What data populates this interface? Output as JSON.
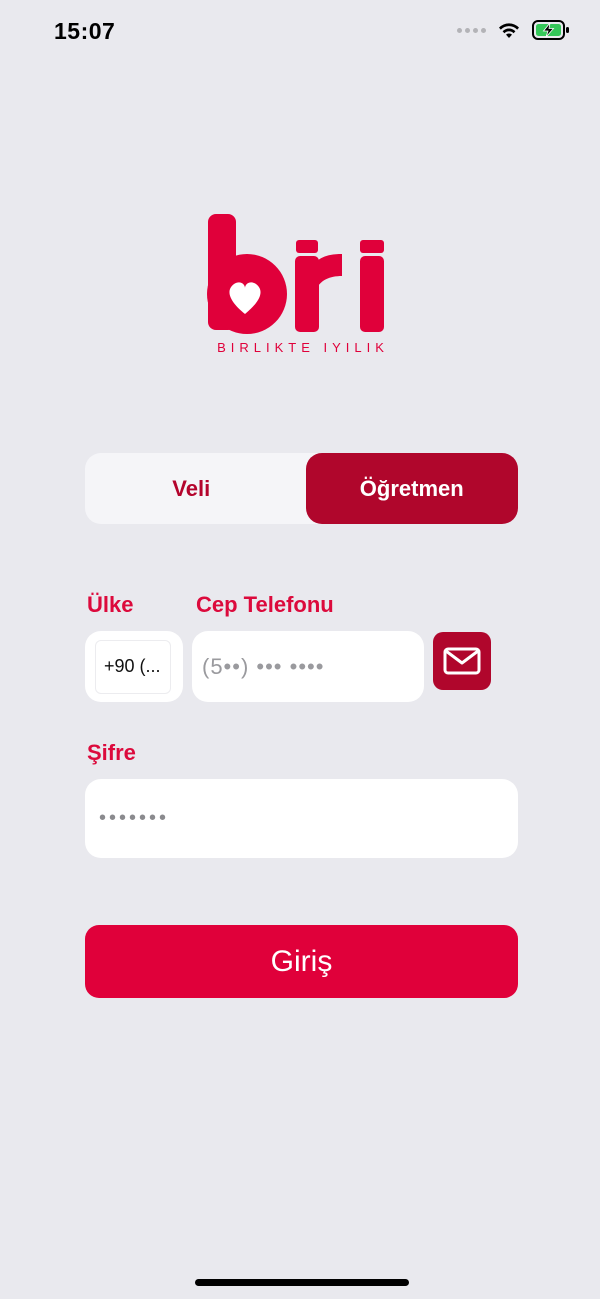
{
  "status_bar": {
    "time": "15:07",
    "icons": [
      "signal-dots-icon",
      "wifi-icon",
      "battery-charging-icon"
    ]
  },
  "logo": {
    "wordmark": "biri",
    "tagline": "BIRLIKTE IYILIK",
    "color": "#e0003a"
  },
  "segmented": {
    "options": [
      "Veli",
      "Öğretmen"
    ],
    "selected": "Öğretmen",
    "active_color": "#b0062c"
  },
  "form": {
    "country_label": "Ülke",
    "country_value": "+90 (...",
    "phone_label": "Cep Telefonu",
    "phone_placeholder": "(5••) ••• ••••",
    "password_label": "Şifre",
    "password_value": "•••••••",
    "mail_icon": "envelope-icon"
  },
  "actions": {
    "login_label": "Giriş",
    "login_color": "#e0003a"
  }
}
